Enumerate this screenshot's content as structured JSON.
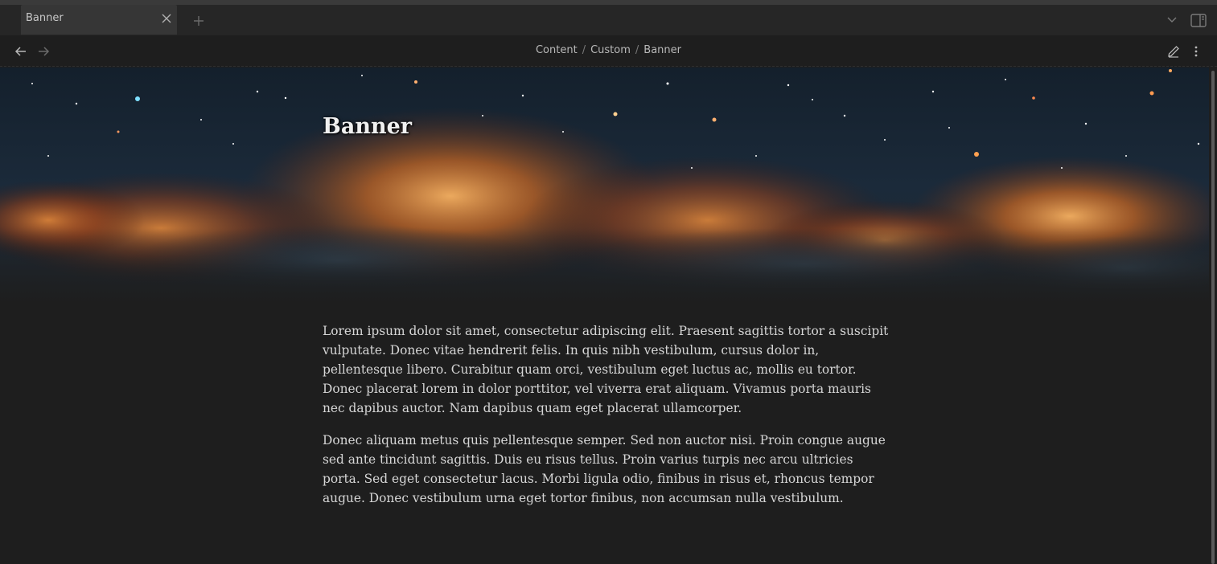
{
  "tab": {
    "title": "Banner"
  },
  "breadcrumb": {
    "items": [
      "Content",
      "Custom",
      "Banner"
    ],
    "separator": "/"
  },
  "page": {
    "title": "Banner",
    "paragraphs": [
      "Lorem ipsum dolor sit amet, consectetur adipiscing elit. Praesent sagittis tortor a suscipit vulputate. Donec vitae hendrerit felis. In quis nibh vestibulum, cursus dolor in, pellentesque libero. Curabitur quam orci, vestibulum eget luctus ac, mollis eu tortor. Donec placerat lorem in dolor porttitor, vel viverra erat aliquam. Vivamus porta mauris nec dapibus auctor. Nam dapibus quam eget placerat ullamcorper.",
      "Donec aliquam metus quis pellentesque semper. Sed non auctor nisi. Proin congue augue sed ante tincidunt sagittis. Duis eu risus tellus. Proin varius turpis nec arcu ultricies porta. Sed eget consectetur lacus. Morbi ligula odio, finibus in risus et, rhoncus tempor augue. Donec vestibulum urna eget tortor finibus, non accumsan nulla vestibulum."
    ]
  },
  "icons": {
    "tab_close": "close-icon",
    "new_tab": "plus-icon",
    "tab_menu": "chevron-down-icon",
    "sidebar_toggle": "sidebar-right-icon",
    "back": "arrow-left-icon",
    "forward": "arrow-right-icon",
    "edit": "pencil-icon",
    "more": "more-vertical-icon"
  },
  "colors": {
    "background": "#1e1e1e",
    "tabbar": "#262626",
    "active_tab": "#363636",
    "nebula_orange": "#e8852a",
    "space_blue": "#1b2a3a"
  }
}
